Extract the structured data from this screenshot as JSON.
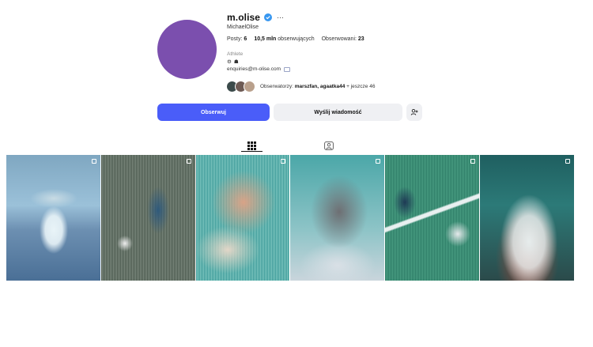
{
  "profile": {
    "username": "m.olise",
    "full_name": "MichaelOlise",
    "more_label": "···",
    "stats": {
      "posts_label": "Posty:",
      "posts_value": "6",
      "followers_value": "10,5 mln",
      "followers_label": "obserwujących",
      "following_label": "Obserwowani:",
      "following_value": "23"
    },
    "category": "Athlete",
    "bio_emojis": [
      "⚙",
      "☗"
    ],
    "email": "enquiries@m-olise.com",
    "followed_by": {
      "prefix": "Obserwatorzy:",
      "names": "marszfan, agaatka44",
      "suffix": "+ jeszcze 46"
    }
  },
  "actions": {
    "follow_label": "Obserwuj",
    "message_label": "Wyślij wiadomość"
  },
  "tabs": {
    "posts_icon": "grid-icon",
    "tagged_icon": "tagged-icon"
  },
  "posts": [
    {
      "icon": "multi-post-icon"
    },
    {
      "icon": "multi-post-icon"
    },
    {
      "icon": "multi-post-icon"
    },
    {
      "icon": "multi-post-icon"
    },
    {
      "icon": "multi-post-icon"
    },
    {
      "icon": "multi-post-icon"
    }
  ],
  "colors": {
    "accent": "#4a5df9",
    "avatar": "#7b4fae",
    "verified": "#3897f0"
  }
}
